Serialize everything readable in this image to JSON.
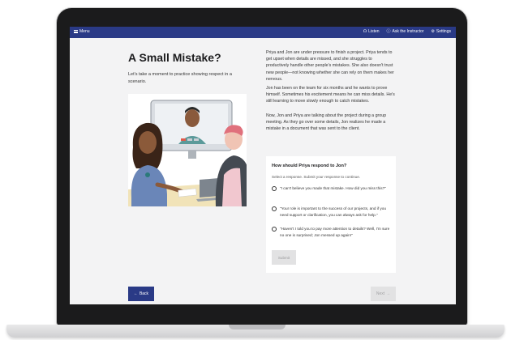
{
  "topbar": {
    "menu_label": "Menu",
    "listen_label": "Listen",
    "instructor_label": "Ask the Instructor",
    "settings_label": "Settings"
  },
  "lesson": {
    "title": "A Small Mistake?",
    "subtitle": "Let's take a moment to practice showing respect in a scenario.",
    "paragraphs": [
      "Priya and Jon are under pressure to finish a project. Priya tends to get upset when details are missed, and she struggles to productively handle other people's mistakes. She also doesn't trust new people—not knowing whether she can rely on them makes her nervous.",
      "Jon has been on the team for six months and he wants to prove himself. Sometimes his excitement means he can miss details. He's still learning to move slowly enough to catch mistakes.",
      "Now, Jon and Priya are talking about the project during a group meeting. As they go over some details, Jon realizes he made a mistake in a document that was sent to the client."
    ]
  },
  "question": {
    "title": "How should Priya respond to Jon?",
    "instruction": "Select a response. Submit your response to continue.",
    "options": [
      "\"I can't believe you made that mistake. How did you miss this?\"",
      "\"Your role is important to the success of our projects, and if you need support or clarification, you can always ask for help.\"",
      "\"Haven't I told you to pay more attention to details? Well, I'm sure no one is surprised; Jon messed up again!\""
    ],
    "submit_label": "Submit"
  },
  "nav": {
    "back_label": "Back",
    "next_label": "Next"
  },
  "colors": {
    "brand": "#2a3a86",
    "disabled_bg": "#e2e2e3",
    "page_bg": "#f3f3f4"
  },
  "icons": {
    "menu": "hamburger-icon",
    "listen": "headphones-icon",
    "instructor": "help-circle-icon",
    "settings": "gear-icon",
    "back": "arrow-left-icon",
    "next": "arrow-right-icon"
  }
}
